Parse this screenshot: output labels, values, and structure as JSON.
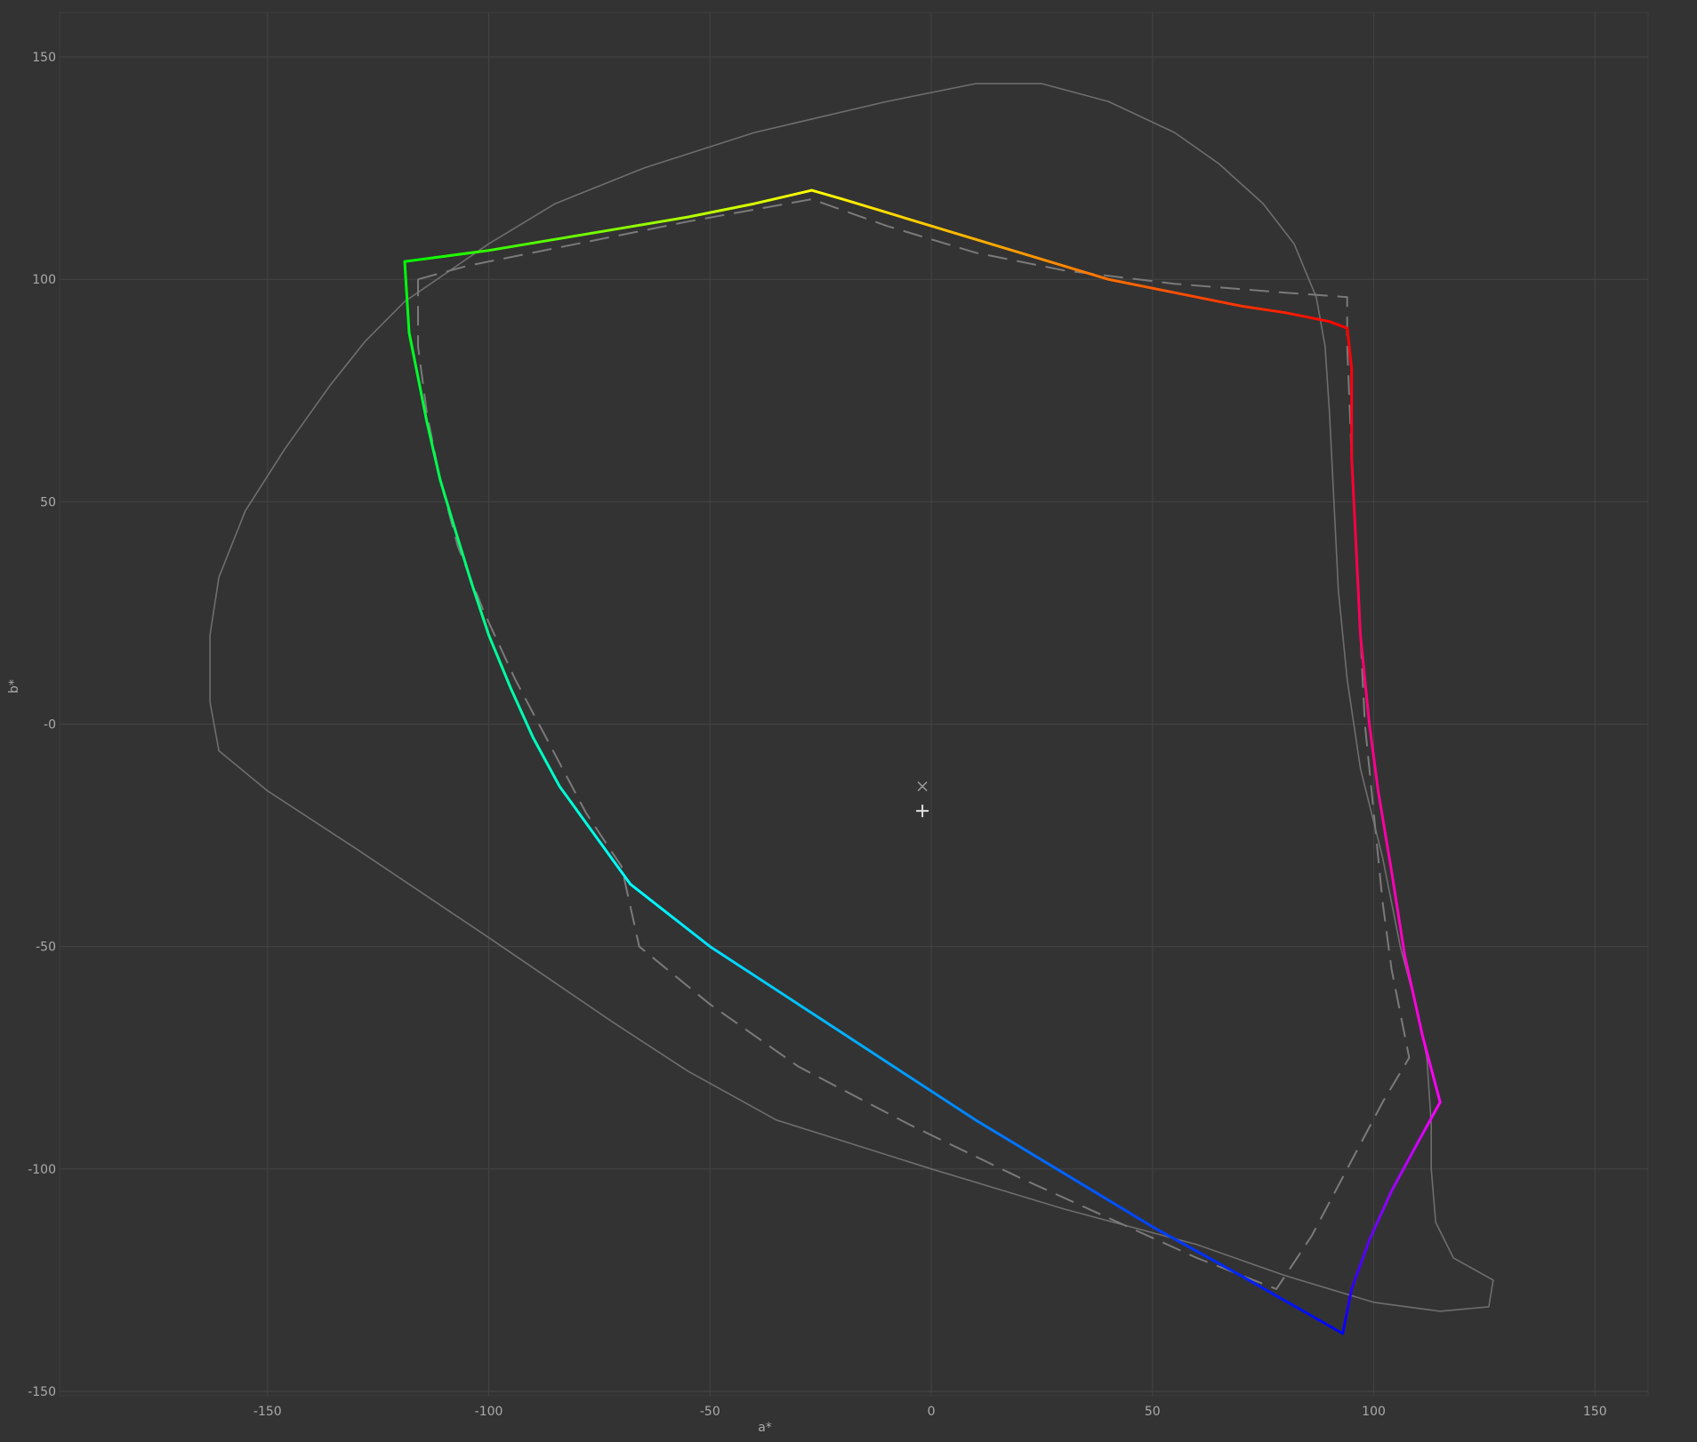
{
  "chart_data": {
    "type": "line",
    "title": "",
    "xlabel": "a*",
    "ylabel": "b*",
    "xlim": [
      -197,
      162
    ],
    "ylim": [
      -151,
      160
    ],
    "xticks": [
      -150,
      -100,
      -50,
      0,
      50,
      100,
      150
    ],
    "xtick_labels": [
      "-150",
      "-100",
      "-50",
      "0",
      "50",
      "100",
      "150"
    ],
    "yticks": [
      150,
      100,
      50,
      0,
      -50,
      -100,
      -150
    ],
    "ytick_labels": [
      "150",
      "100",
      "50",
      "-0",
      "-50",
      "-100",
      "-150"
    ],
    "grid": true,
    "colors": {
      "background": "#333333",
      "grid": "#444444",
      "axis_text": "#aaaaaa",
      "reference_outline": "#6e6e6e",
      "dashed_gamut": "#7a7a7a",
      "white_markers": "#e0e0e0"
    },
    "series": [
      {
        "style": "solid-thin-gray",
        "points": [
          [
            -163,
            20
          ],
          [
            -161,
            33
          ],
          [
            -155,
            48
          ],
          [
            -146,
            62
          ],
          [
            -136,
            76
          ],
          [
            -128,
            86
          ],
          [
            -119,
            95
          ],
          [
            -100,
            108
          ],
          [
            -85,
            117
          ],
          [
            -65,
            125
          ],
          [
            -40,
            133
          ],
          [
            -10,
            140
          ],
          [
            10,
            144
          ],
          [
            25,
            144
          ],
          [
            40,
            140
          ],
          [
            55,
            133
          ],
          [
            65,
            126
          ],
          [
            75,
            117
          ],
          [
            82,
            108
          ],
          [
            87,
            96
          ],
          [
            89,
            85
          ],
          [
            90,
            70
          ],
          [
            91,
            50
          ],
          [
            92,
            30
          ],
          [
            94,
            10
          ],
          [
            97,
            -10
          ],
          [
            102,
            -30
          ],
          [
            106,
            -50
          ],
          [
            110,
            -65
          ],
          [
            112,
            -75
          ],
          [
            113,
            -90
          ],
          [
            113,
            -100
          ],
          [
            114,
            -112
          ],
          [
            118,
            -120
          ],
          [
            127,
            -125
          ],
          [
            126,
            -131
          ],
          [
            115,
            -132
          ],
          [
            100,
            -130
          ],
          [
            80,
            -124
          ],
          [
            60,
            -117
          ],
          [
            30,
            -109
          ],
          [
            0,
            -100
          ],
          [
            -35,
            -89
          ],
          [
            -55,
            -78
          ],
          [
            -72,
            -67
          ],
          [
            -100,
            -48
          ],
          [
            -130,
            -28
          ],
          [
            -150,
            -15
          ],
          [
            -161,
            -6
          ],
          [
            -163,
            5
          ],
          [
            -163,
            20
          ]
        ]
      },
      {
        "style": "dashed-gray",
        "points": [
          [
            -116,
            100
          ],
          [
            -105,
            103
          ],
          [
            -80,
            108
          ],
          [
            -55,
            113
          ],
          [
            -27,
            118
          ],
          [
            -10,
            112
          ],
          [
            10,
            106
          ],
          [
            30,
            102
          ],
          [
            55,
            99
          ],
          [
            80,
            97
          ],
          [
            94,
            96
          ],
          [
            94,
            85
          ],
          [
            95,
            60
          ],
          [
            96,
            40
          ],
          [
            97,
            20
          ],
          [
            98,
            0
          ],
          [
            100,
            -20
          ],
          [
            102,
            -40
          ],
          [
            104,
            -55
          ],
          [
            107,
            -70
          ],
          [
            108,
            -75
          ],
          [
            102,
            -85
          ],
          [
            94,
            -100
          ],
          [
            86,
            -115
          ],
          [
            78,
            -127
          ],
          [
            60,
            -120
          ],
          [
            40,
            -111
          ],
          [
            20,
            -102
          ],
          [
            -5,
            -90
          ],
          [
            -30,
            -77
          ],
          [
            -50,
            -63
          ],
          [
            -66,
            -50
          ],
          [
            -70,
            -32
          ],
          [
            -78,
            -20
          ],
          [
            -86,
            -5
          ],
          [
            -94,
            10
          ],
          [
            -101,
            25
          ],
          [
            -107,
            40
          ],
          [
            -111,
            55
          ],
          [
            -114,
            70
          ],
          [
            -116,
            85
          ],
          [
            -116,
            100
          ]
        ]
      },
      {
        "style": "hue-gradient",
        "vertices": [
          {
            "name": "R",
            "a": 94,
            "b": 89,
            "color": "#ff0000"
          },
          {
            "name": "Y",
            "a": -27,
            "b": 120,
            "color": "#ffff00"
          },
          {
            "name": "G",
            "a": -119,
            "b": 104,
            "color": "#00ff00"
          },
          {
            "name": "C",
            "a": -68,
            "b": -36,
            "color": "#00ffff"
          },
          {
            "name": "B",
            "a": 93,
            "b": -137,
            "color": "#0000ff"
          },
          {
            "name": "M",
            "a": 115,
            "b": -85,
            "color": "#ff00ff"
          }
        ],
        "edges": [
          {
            "from": "R",
            "to": "Y",
            "points": [
              [
                94,
                89
              ],
              [
                90,
                90.5
              ],
              [
                80,
                92.5
              ],
              [
                70,
                94
              ],
              [
                60,
                96
              ],
              [
                50,
                98
              ],
              [
                40,
                100
              ],
              [
                30,
                103
              ],
              [
                20,
                106
              ],
              [
                10,
                109
              ],
              [
                0,
                112
              ],
              [
                -10,
                115
              ],
              [
                -20,
                118
              ],
              [
                -27,
                120
              ]
            ],
            "colors": [
              "#ff0000",
              "#ff8000",
              "#ffff00"
            ]
          },
          {
            "from": "Y",
            "to": "G",
            "points": [
              [
                -27,
                120
              ],
              [
                -40,
                117
              ],
              [
                -55,
                114
              ],
              [
                -70,
                111.5
              ],
              [
                -85,
                109
              ],
              [
                -100,
                106.5
              ],
              [
                -119,
                104
              ]
            ],
            "colors": [
              "#ffff00",
              "#80ff00",
              "#00ff00"
            ]
          },
          {
            "from": "G",
            "to": "C",
            "points": [
              [
                -119,
                104
              ],
              [
                -118,
                88
              ],
              [
                -116,
                78
              ],
              [
                -114,
                68
              ],
              [
                -111,
                55
              ],
              [
                -108,
                45
              ],
              [
                -104,
                32
              ],
              [
                -100,
                20
              ],
              [
                -95,
                8
              ],
              [
                -90,
                -3
              ],
              [
                -84,
                -14
              ],
              [
                -76,
                -25
              ],
              [
                -68,
                -36
              ]
            ],
            "colors": [
              "#00ff00",
              "#00ff80",
              "#00ffff"
            ]
          },
          {
            "from": "C",
            "to": "B",
            "points": [
              [
                -68,
                -36
              ],
              [
                -50,
                -50
              ],
              [
                -30,
                -63
              ],
              [
                -10,
                -76
              ],
              [
                10,
                -89
              ],
              [
                30,
                -101
              ],
              [
                50,
                -113
              ],
              [
                70,
                -124
              ],
              [
                93,
                -137
              ]
            ],
            "colors": [
              "#00ffff",
              "#0080ff",
              "#0000ff"
            ]
          },
          {
            "from": "B",
            "to": "M",
            "points": [
              [
                93,
                -137
              ],
              [
                95,
                -127
              ],
              [
                99,
                -116
              ],
              [
                104,
                -105
              ],
              [
                110,
                -94
              ],
              [
                115,
                -85
              ]
            ],
            "colors": [
              "#0000ff",
              "#8000ff",
              "#ff00ff"
            ]
          },
          {
            "from": "M",
            "to": "R",
            "points": [
              [
                115,
                -85
              ],
              [
                111,
                -70
              ],
              [
                107,
                -52
              ],
              [
                104,
                -33
              ],
              [
                101,
                -15
              ],
              [
                99,
                0
              ],
              [
                97,
                20
              ],
              [
                96,
                40
              ],
              [
                95,
                60
              ],
              [
                95,
                80
              ],
              [
                94,
                89
              ]
            ],
            "colors": [
              "#ff00ff",
              "#ff0080",
              "#ff0000"
            ]
          }
        ]
      }
    ],
    "markers": [
      {
        "shape": "x",
        "a": -2,
        "b": -14
      },
      {
        "shape": "+",
        "a": -2,
        "b": -19.5
      }
    ]
  }
}
